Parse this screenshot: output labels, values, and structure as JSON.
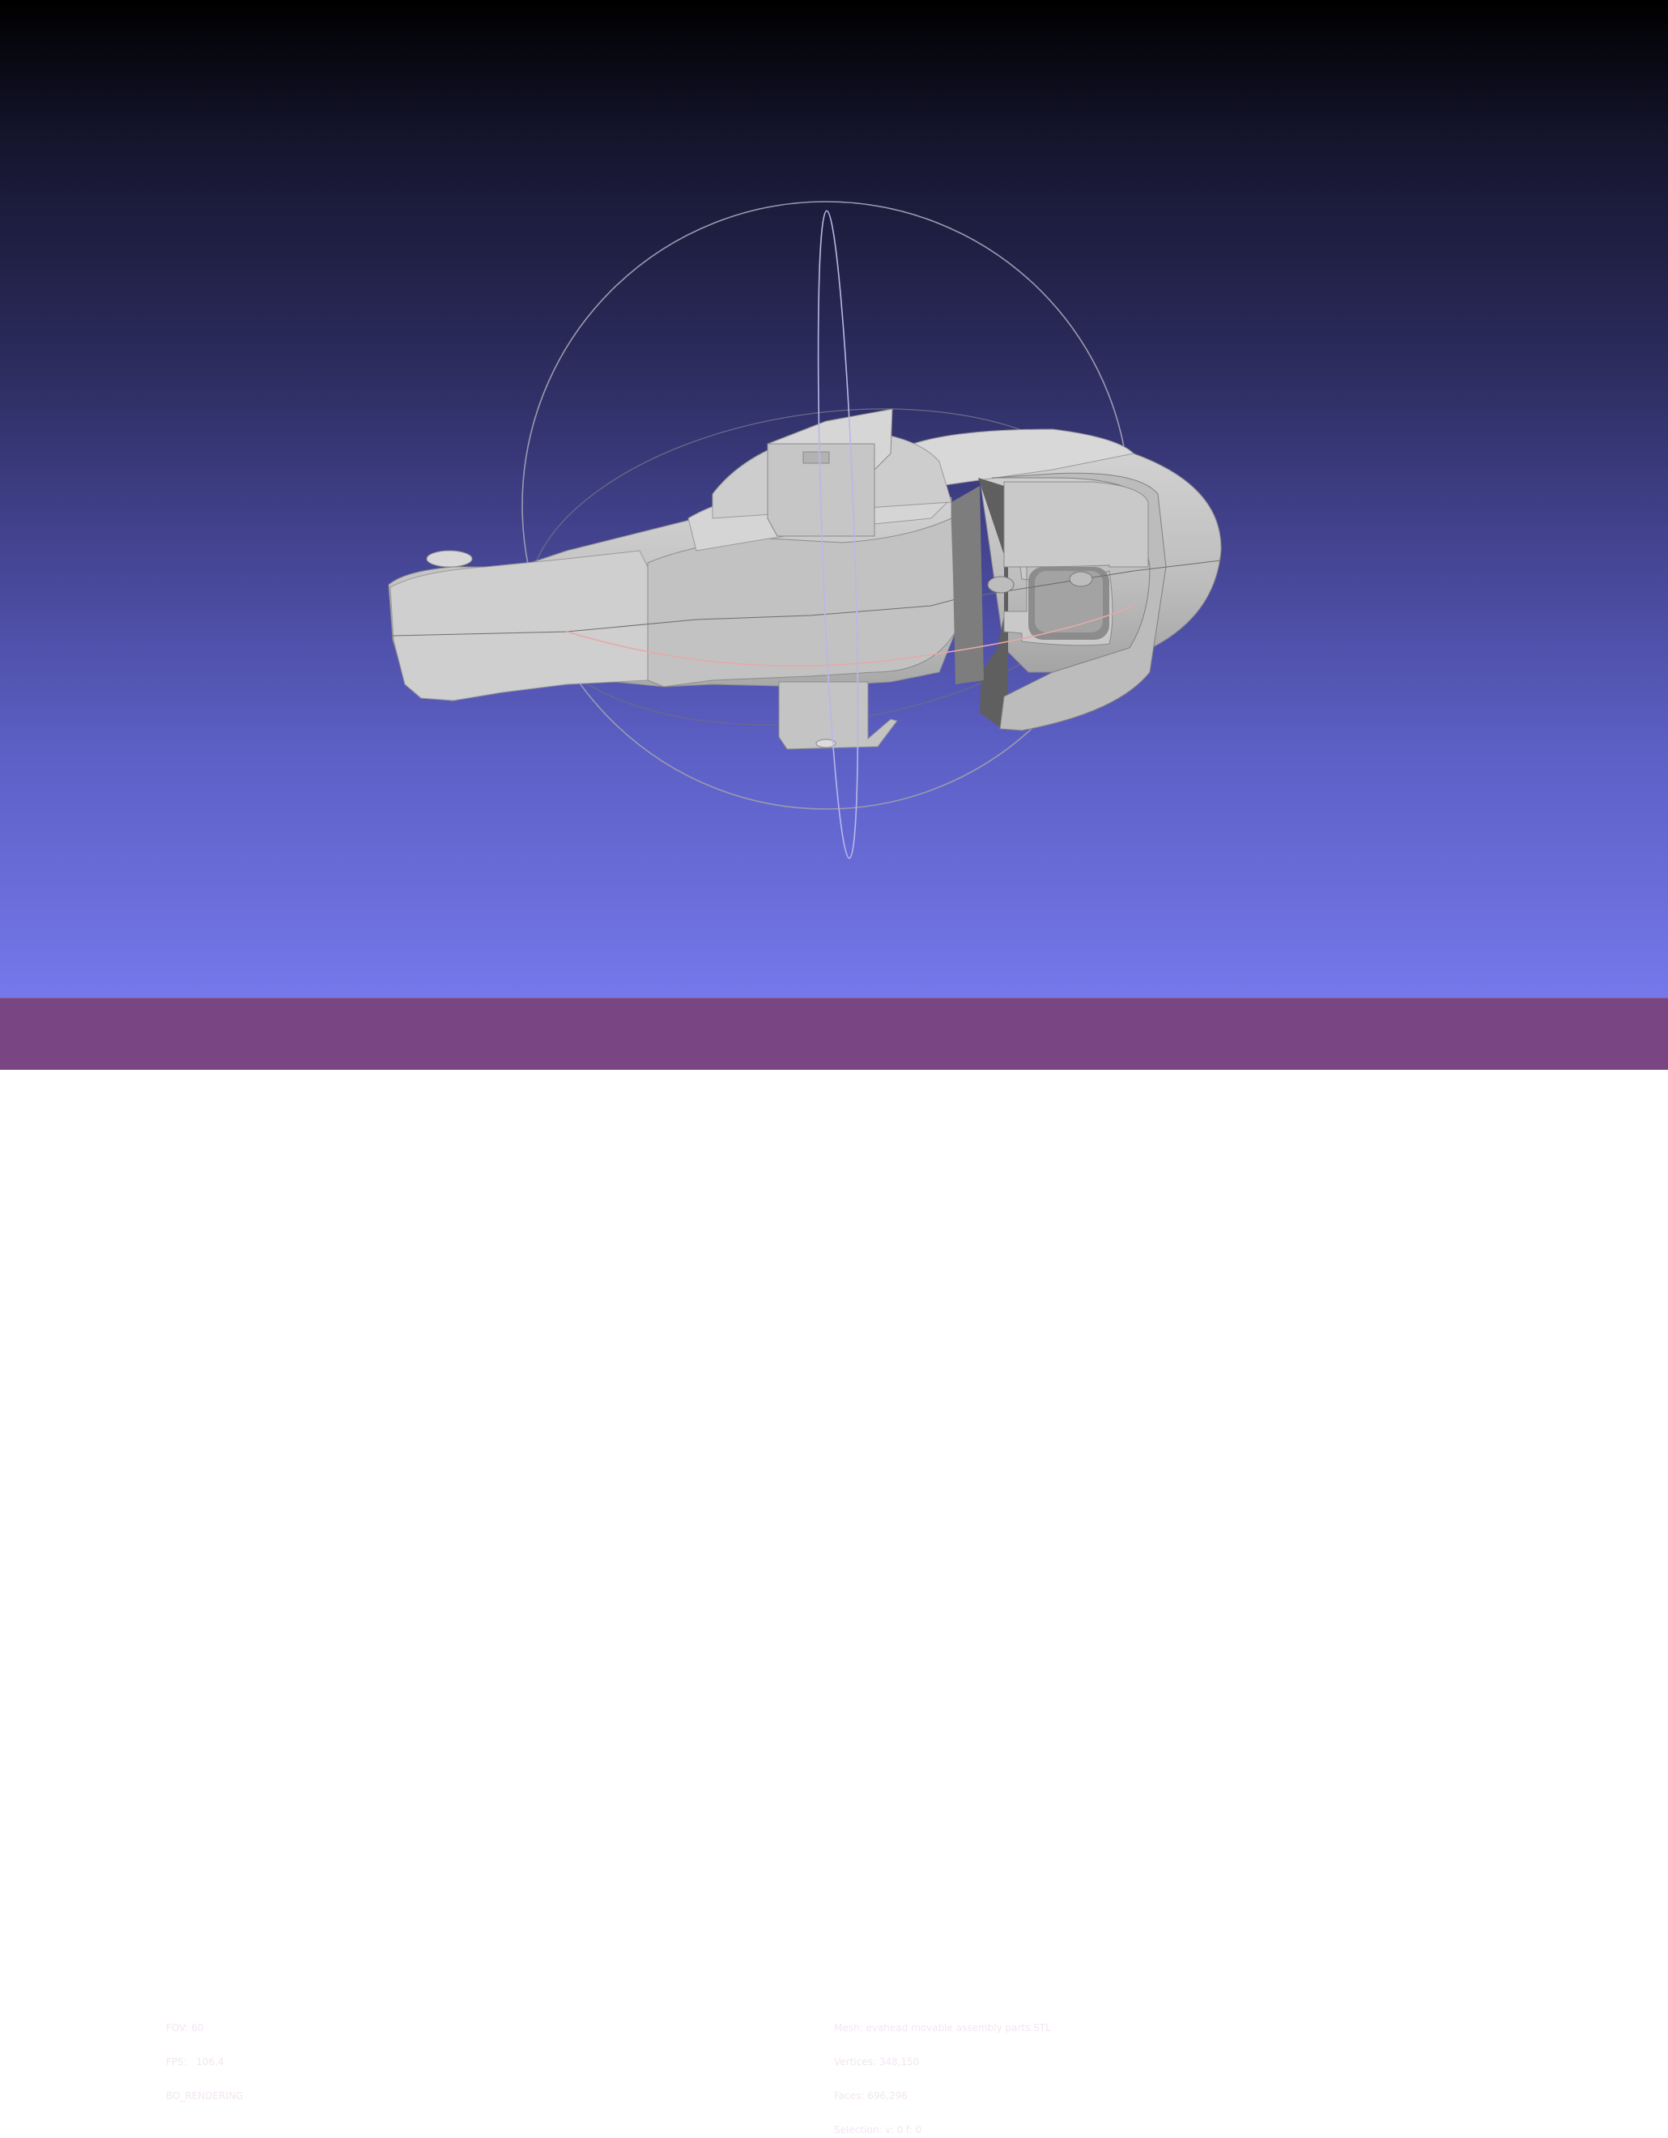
{
  "viewer": {
    "background_top": "#000000",
    "background_bottom": "#7478ea",
    "mesh_color": "#c8c8c8",
    "trackball_colors": {
      "horizontal": "#d08a8a",
      "vertical": "#b8b8e8",
      "outer": "#9a9ab0"
    }
  },
  "render_info": {
    "fov_label": "FOV:",
    "fov_value": "60",
    "fps_label": "FPS:",
    "fps_value": "106.4",
    "mode": "BO_RENDERING"
  },
  "mesh_info": {
    "mesh_label": "Mesh:",
    "mesh_name": "evahead movable assembly parts.STL",
    "vertices_label": "Vertices:",
    "vertices": "348,150",
    "faces_label": "Faces:",
    "faces": "696,296",
    "selection_label": "Selection:",
    "selection": "v: 0 f: 0"
  }
}
